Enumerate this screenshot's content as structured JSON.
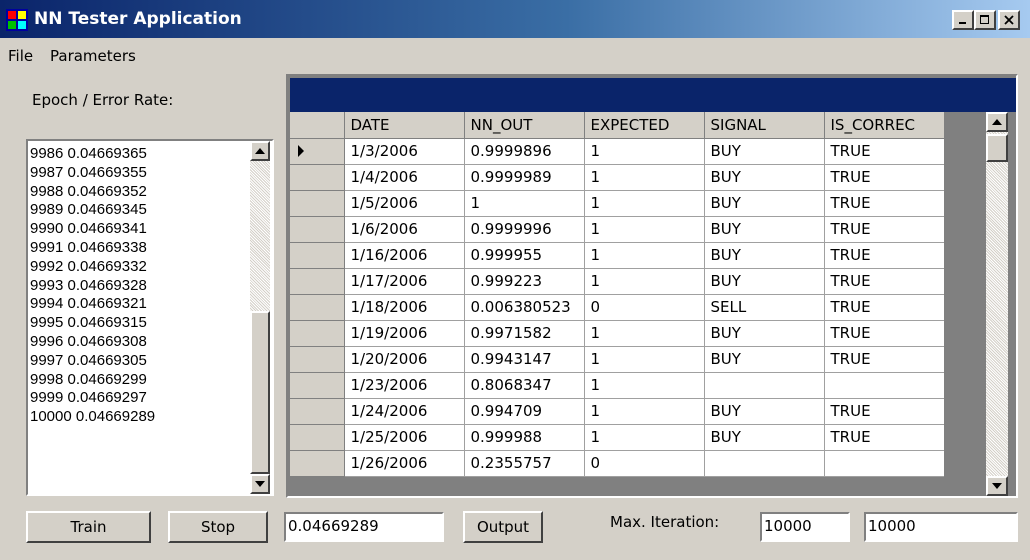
{
  "window": {
    "title": "NN Tester Application"
  },
  "menu": {
    "items": [
      "File",
      "Parameters"
    ]
  },
  "epoch_panel": {
    "label": "Epoch / Error Rate:",
    "entries": [
      "9986 0.04669365",
      "9987 0.04669355",
      "9988 0.04669352",
      "9989 0.04669345",
      "9990 0.04669341",
      "9991 0.04669338",
      "9992 0.04669332",
      "9993 0.04669328",
      "9994 0.04669321",
      "9995 0.04669315",
      "9996 0.04669308",
      "9997 0.04669305",
      "9998 0.04669299",
      "9999 0.04669297",
      "10000 0.04669289"
    ]
  },
  "grid": {
    "columns": [
      "DATE",
      "NN_OUT",
      "EXPECTED",
      "SIGNAL",
      "IS_CORREC"
    ],
    "rows": [
      [
        "1/3/2006",
        "0.9999896",
        "1",
        "BUY",
        "TRUE"
      ],
      [
        "1/4/2006",
        "0.9999989",
        "1",
        "BUY",
        "TRUE"
      ],
      [
        "1/5/2006",
        "1",
        "1",
        "BUY",
        "TRUE"
      ],
      [
        "1/6/2006",
        "0.9999996",
        "1",
        "BUY",
        "TRUE"
      ],
      [
        "1/16/2006",
        "0.999955",
        "1",
        "BUY",
        "TRUE"
      ],
      [
        "1/17/2006",
        "0.999223",
        "1",
        "BUY",
        "TRUE"
      ],
      [
        "1/18/2006",
        "0.006380523",
        "0",
        "SELL",
        "TRUE"
      ],
      [
        "1/19/2006",
        "0.9971582",
        "1",
        "BUY",
        "TRUE"
      ],
      [
        "1/20/2006",
        "0.9943147",
        "1",
        "BUY",
        "TRUE"
      ],
      [
        "1/23/2006",
        "0.8068347",
        "1",
        "",
        ""
      ],
      [
        "1/24/2006",
        "0.994709",
        "1",
        "BUY",
        "TRUE"
      ],
      [
        "1/25/2006",
        "0.999988",
        "1",
        "BUY",
        "TRUE"
      ],
      [
        "1/26/2006",
        "0.2355757",
        "0",
        "",
        ""
      ]
    ],
    "current_row_icon": "row-pointer-icon"
  },
  "controls": {
    "train_label": "Train",
    "stop_label": "Stop",
    "error_value": "0.04669289",
    "output_label": "Output",
    "max_iteration_label": "Max. Iteration:",
    "max_iteration_value": "10000",
    "iteration_value": "10000"
  },
  "colors": {
    "titlebar_start": "#0a246a",
    "titlebar_end": "#a6caf0",
    "face": "#d4d0c8",
    "grid_header_band": "#0a246a"
  }
}
